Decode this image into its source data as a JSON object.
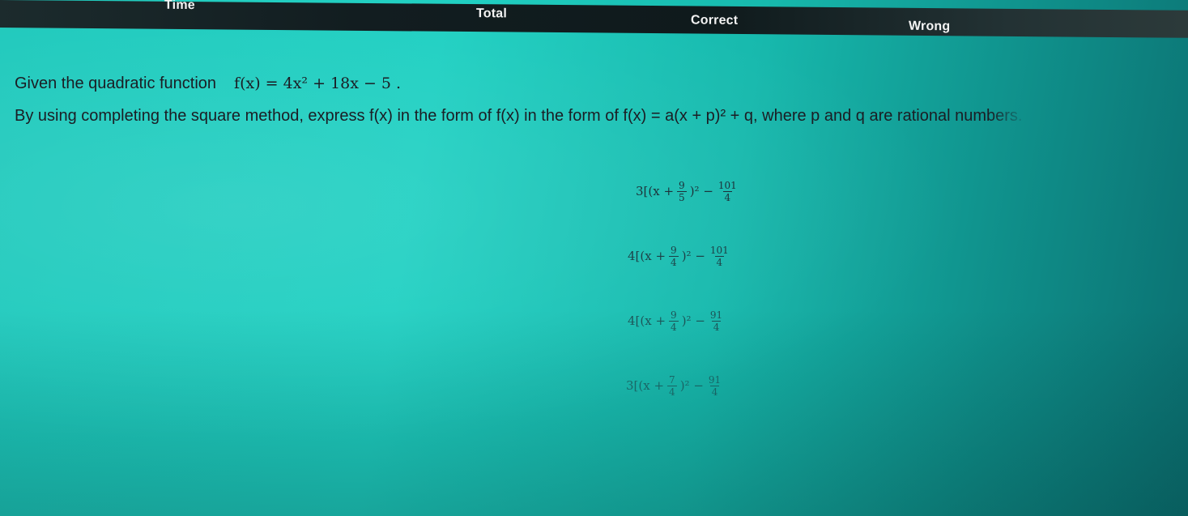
{
  "header": {
    "time_label": "Time",
    "total_label": "Total",
    "correct_label": "Correct",
    "wrong_label": "Wrong"
  },
  "question": {
    "intro": "Given the quadratic function",
    "function_text": "f(x) = 4x² + 18x − 5 .",
    "prompt_main": "By using completing the square method, express f(x) in the form of f(x) in the form of f(x) = a(x + p)² + q, where p and q are rational",
    "prompt_tail": " numbers."
  },
  "options": [
    {
      "prefix": "3[(x +",
      "frac_num": "9",
      "frac_den": "5",
      "mid": ")² −",
      "const_num": "101",
      "const_den": "4"
    },
    {
      "prefix": "4[(x +",
      "frac_num": "9",
      "frac_den": "4",
      "mid": ")² −",
      "const_num": "101",
      "const_den": "4"
    },
    {
      "prefix": "4[(x +",
      "frac_num": "9",
      "frac_den": "4",
      "mid": ")² −",
      "const_num": "91",
      "const_den": "4"
    },
    {
      "prefix": "3[(x +",
      "frac_num": "7",
      "frac_den": "4",
      "mid": ")² −",
      "const_num": "91",
      "const_den": "4"
    }
  ]
}
